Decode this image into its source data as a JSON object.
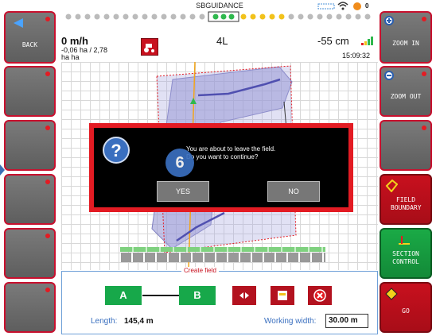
{
  "title": "SBGUIDANCE",
  "left_buttons": [
    {
      "label": "BACK"
    },
    {
      "label": ""
    },
    {
      "label": ""
    },
    {
      "label": ""
    },
    {
      "label": ""
    },
    {
      "label": ""
    }
  ],
  "right_buttons": [
    {
      "label": "ZOOM IN"
    },
    {
      "label": "ZOOM OUT"
    },
    {
      "label": ""
    },
    {
      "label": "FIELD BOUNDARY"
    },
    {
      "label": "SECTION CONTROL"
    },
    {
      "label": "GO"
    }
  ],
  "speed": "0 m/h",
  "area_line1": "-0,06 ha / 2,78",
  "area_line2": "ha ha",
  "center_value": "4L",
  "offset": "-55 cm",
  "clock": "15:09:32",
  "satellites": "0",
  "dialog": {
    "message_line1": "You are about to leave the field.",
    "message_line2": "Do you want to continue?",
    "yes": "YES",
    "no": "NO",
    "badge": "6"
  },
  "panel": {
    "title": "Create field",
    "a_label": "A",
    "b_label": "B",
    "length_label": "Length:",
    "length_value": "145,4 m",
    "width_label": "Working width:",
    "width_value": "30.00 m"
  },
  "colors": {
    "accent_red": "#e31b23",
    "green": "#17a84a",
    "field": "#8f8fcf"
  },
  "icons": [
    "back-arrow-icon",
    "zoom-in-icon",
    "zoom-out-icon",
    "field-boundary-icon",
    "section-control-icon",
    "go-icon",
    "tractor-icon",
    "wifi-icon",
    "gps-icon",
    "question-icon"
  ]
}
